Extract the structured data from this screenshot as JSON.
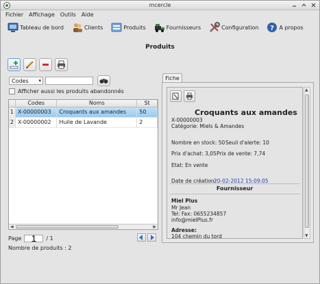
{
  "window": {
    "title": "mcercle"
  },
  "menu": [
    "Fichier",
    "Affichage",
    "Outils",
    "Aide"
  ],
  "toolbar": [
    {
      "label": "Tableau de bord",
      "icon": "dashboard-icon"
    },
    {
      "label": "Clients",
      "icon": "clients-icon"
    },
    {
      "label": "Produits",
      "icon": "products-icon"
    },
    {
      "label": "Fournisseurs",
      "icon": "suppliers-icon"
    },
    {
      "label": "Configuration",
      "icon": "tools-icon"
    },
    {
      "label": "A propos",
      "icon": "help-icon"
    }
  ],
  "page": {
    "title": "Produits"
  },
  "search": {
    "field": "Codes",
    "value": ""
  },
  "show_abandoned": {
    "label": "Afficher aussi les produits abandonnés",
    "checked": false
  },
  "table": {
    "columns": [
      "Codes",
      "Noms",
      "St"
    ],
    "rows": [
      {
        "n": "1",
        "code": "X-00000003",
        "name": "Croquants aux amandes",
        "stock": "50",
        "selected": true
      },
      {
        "n": "2",
        "code": "X-00000002",
        "name": "Huile de Lavande",
        "stock": "2",
        "selected": false
      }
    ]
  },
  "pager": {
    "label": "Page",
    "current": "1",
    "total": "/ 1"
  },
  "count": "Nombre de produits : 2",
  "tab": {
    "label": "Fiche"
  },
  "fiche": {
    "name": "Croquants aux amandes",
    "code": "X-00000003",
    "category": "Catégorie: Miels & Amandes",
    "stock": "Nombre en stock: 50",
    "alert": "Seuil d'alerte: 10",
    "buy_price": "Prix d'achat: 3,05",
    "sell_price": "Prix de vente: 7,74",
    "state": "Etat: En vente",
    "date_label": "Date de création:",
    "date_value": "20-02-2012 15:09:05",
    "supplier_title": "Fournisseur",
    "supplier_name": "Miel Plus",
    "contact": "Mr Jean",
    "tel": "Tel:    Fax: 0655234857",
    "email": "info@mielPlus.fr",
    "address_label": "Adresse:",
    "address": "104 chemin du tord"
  }
}
